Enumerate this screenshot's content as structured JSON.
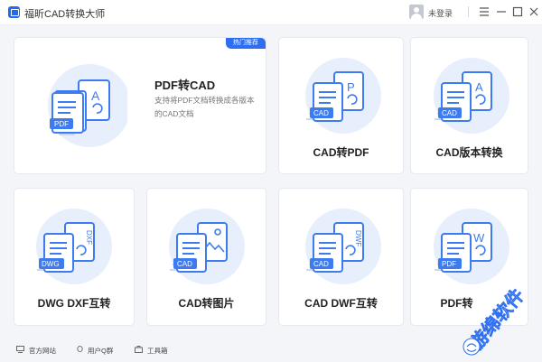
{
  "app": {
    "title": "福昕CAD转换大师"
  },
  "header": {
    "login_label": "未登录"
  },
  "featured": {
    "title": "PDF转CAD",
    "description": "支持将PDF文档转换成各版本的CAD文档",
    "badge": "热门推荐",
    "doc_tag": "PDF",
    "doc_letter": "A"
  },
  "tools": [
    {
      "label": "CAD转PDF",
      "doc_tag": "CAD",
      "doc_letter": "P"
    },
    {
      "label": "CAD版本转换",
      "doc_tag": "CAD",
      "doc_letter": "A"
    },
    {
      "label": "DWG DXF互转",
      "doc_tag": "DWG",
      "doc_letter": "DXF"
    },
    {
      "label": "CAD转图片",
      "doc_tag": "CAD",
      "doc_letter": ""
    },
    {
      "label": "CAD DWF互转",
      "doc_tag": "CAD",
      "doc_letter": "DWF"
    },
    {
      "label": "PDF转",
      "doc_tag": "PDF",
      "doc_letter": "W"
    }
  ],
  "footer": {
    "links": [
      "官方网站",
      "用户Q群",
      "工具箱"
    ]
  },
  "watermark": {
    "text": "游绵软件"
  },
  "colors": {
    "accent": "#2e6ff2",
    "icon_bg": "#e7effd",
    "doc_blue": "#3d7bf0"
  }
}
